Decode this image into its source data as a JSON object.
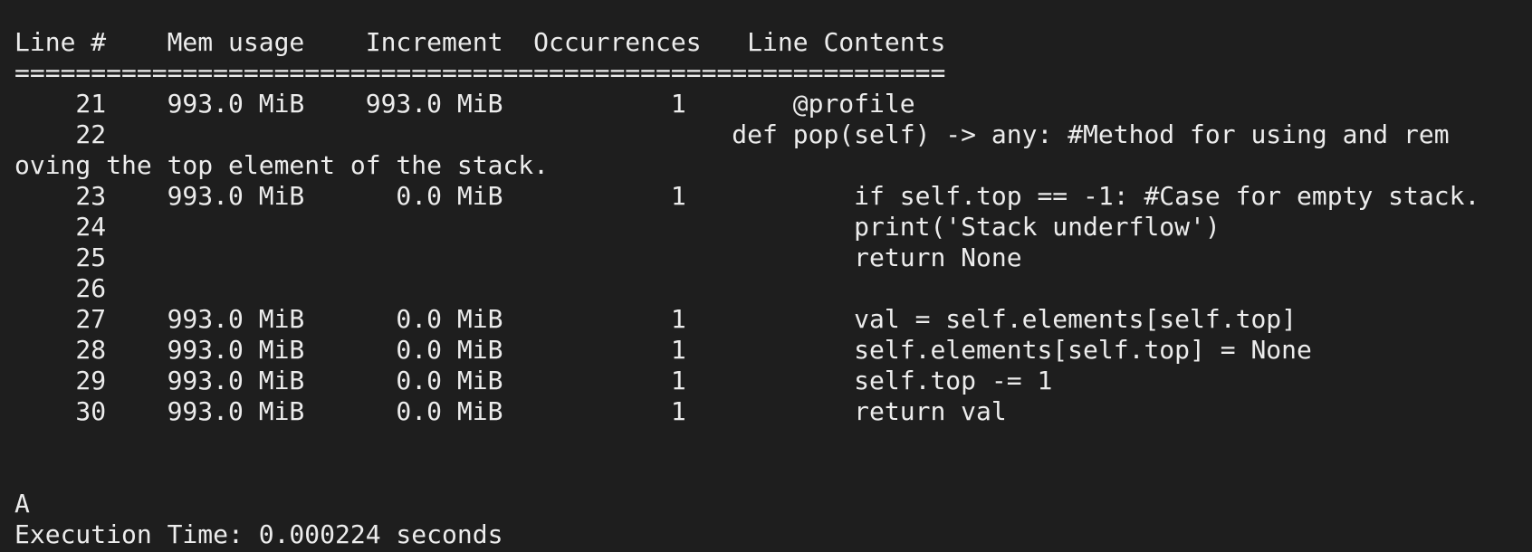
{
  "terminal": {
    "header": "Line #    Mem usage    Increment  Occurrences   Line Contents",
    "separator": "=============================================================",
    "rows": [
      "    21    993.0 MiB    993.0 MiB           1       @profile",
      "    22                                         def pop(self) -> any: #Method for using and rem",
      "oving the top element of the stack.",
      "    23    993.0 MiB      0.0 MiB           1           if self.top == -1: #Case for empty stack.",
      "    24                                                 print('Stack underflow')",
      "    25                                                 return None",
      "    26",
      "    27    993.0 MiB      0.0 MiB           1           val = self.elements[self.top]",
      "    28    993.0 MiB      0.0 MiB           1           self.elements[self.top] = None",
      "    29    993.0 MiB      0.0 MiB           1           self.top -= 1",
      "    30    993.0 MiB      0.0 MiB           1           return val"
    ],
    "output_line": "A",
    "execution_time": "Execution Time: 0.000224 seconds"
  }
}
